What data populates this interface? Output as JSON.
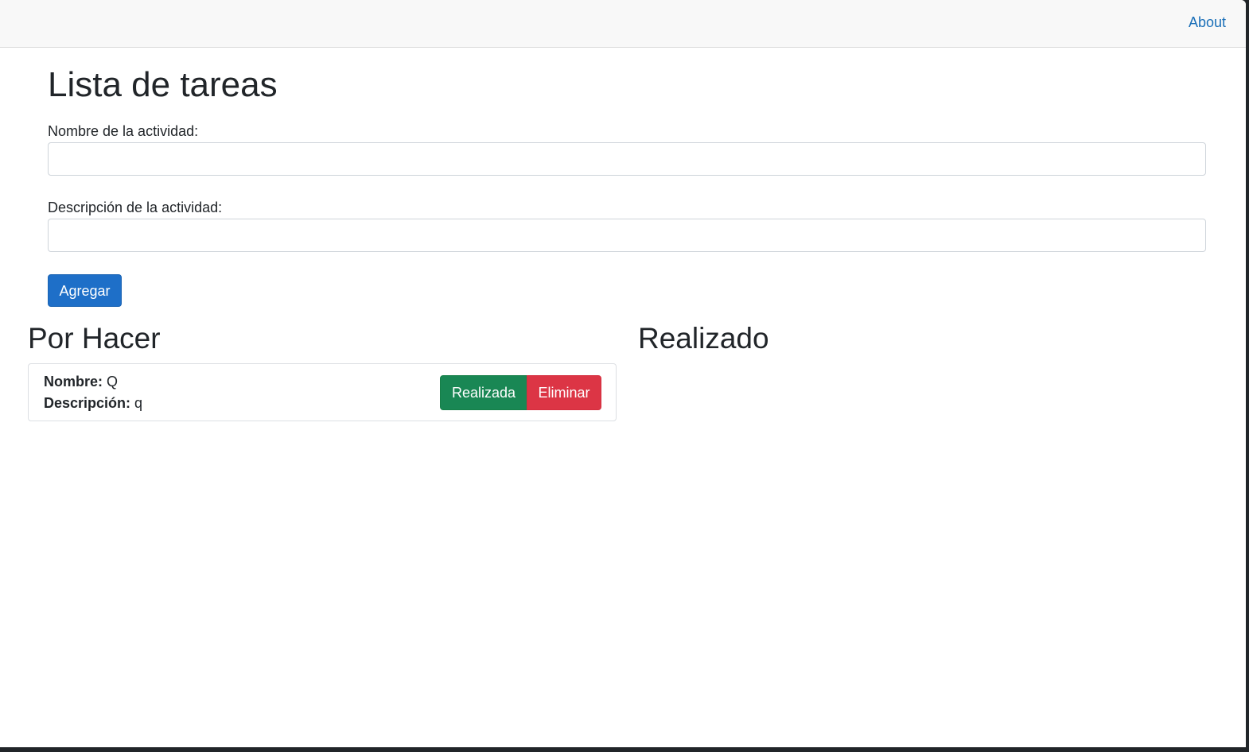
{
  "navbar": {
    "about_label": "About"
  },
  "main": {
    "title": "Lista de tareas",
    "name_field": {
      "label": "Nombre de la actividad:",
      "value": "",
      "placeholder": ""
    },
    "description_field": {
      "label": "Descripción de la actividad:",
      "value": "",
      "placeholder": ""
    },
    "add_button_label": "Agregar"
  },
  "todo": {
    "title": "Por Hacer",
    "tasks": [
      {
        "name_label": "Nombre:",
        "name": "Q",
        "description_label": "Descripción:",
        "description": "q",
        "done_button_label": "Realizada",
        "delete_button_label": "Eliminar"
      }
    ]
  },
  "done": {
    "title": "Realizado",
    "tasks": []
  },
  "colors": {
    "primary": "#1e6fc8",
    "success": "#198754",
    "danger": "#dc3545",
    "link": "#1a6fb8"
  }
}
